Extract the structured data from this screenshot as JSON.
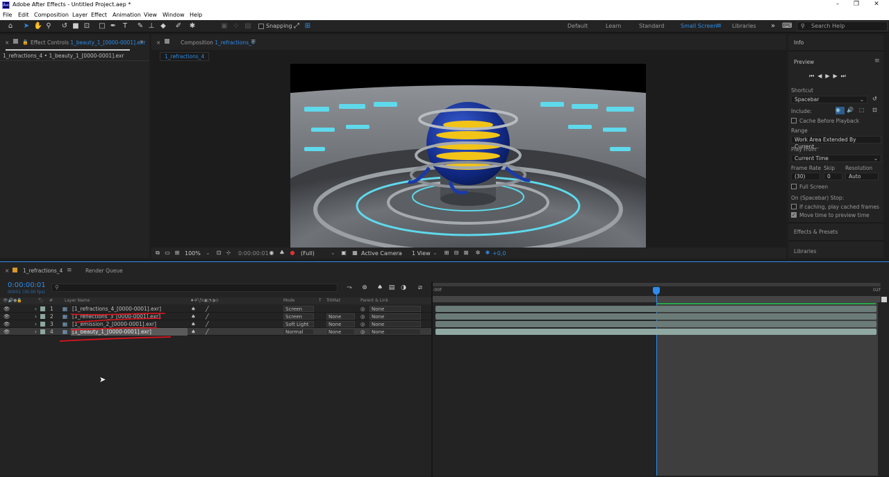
{
  "titlebar": {
    "title": "Adobe After Effects - Untitled Project.aep *",
    "app_icon": "Ae"
  },
  "menu": [
    "File",
    "Edit",
    "Composition",
    "Layer",
    "Effect",
    "Animation",
    "View",
    "Window",
    "Help"
  ],
  "toolbar": {
    "snapping": "Snapping",
    "workspaces": [
      "Default",
      "Learn",
      "Standard",
      "Small Screen",
      "Libraries"
    ],
    "active_workspace": "Small Screen",
    "search_placeholder": "Search Help"
  },
  "effect_controls": {
    "tab_prefix": "Effect Controls",
    "tab_target": "1_beauty_1_[0000-0001].exr",
    "subtitle": "1_refractions_4 • 1_beauty_1_[0000-0001].exr"
  },
  "composition": {
    "tab_prefix": "Composition",
    "tab_name": "1_refractions_4",
    "sub_tab": "1_refractions_4"
  },
  "viewer_bar": {
    "zoom": "100%",
    "time": "0:00:00:01",
    "resolution": "(Full)",
    "camera": "Active Camera",
    "views": "1 View",
    "exposure": "+0,0"
  },
  "right_panel": {
    "info": "Info",
    "preview": "Preview",
    "shortcut_label": "Shortcut",
    "shortcut_value": "Spacebar",
    "include_label": "Include:",
    "cache_before": "Cache Before Playback",
    "range_label": "Range",
    "range_value": "Work Area Extended By Current...",
    "play_from_label": "Play From",
    "play_from_value": "Current Time",
    "frame_rate_label": "Frame Rate",
    "skip_label": "Skip",
    "resolution_label": "Resolution",
    "frame_rate_value": "(30)",
    "skip_value": "0",
    "resolution_value": "Auto",
    "full_screen": "Full Screen",
    "on_stop": "On (Spacebar) Stop:",
    "if_caching": "If caching, play cached frames",
    "move_time": "Move time to preview time",
    "effects_presets": "Effects & Presets",
    "libraries": "Libraries"
  },
  "timeline": {
    "tab": "1_refractions_4",
    "render_queue": "Render Queue",
    "timecode": "0:00:00:01",
    "fps": "00001 (30.00 fps)",
    "cols": {
      "num": "#",
      "layer_name": "Layer Name",
      "mode": "Mode",
      "t": "T",
      "trkmat": "TrkMat",
      "parent": "Parent & Link"
    },
    "ruler": {
      "start": ":00f",
      "end": "02f"
    },
    "layers": [
      {
        "num": "1",
        "name": "[1_refractions_4_[0000-0001].exr]",
        "mode": "Screen",
        "trkmat": "",
        "parent": "None"
      },
      {
        "num": "2",
        "name": "[1_reflections_3_[0000-0001].exr]",
        "mode": "Screen",
        "trkmat": "None",
        "parent": "None"
      },
      {
        "num": "3",
        "name": "[1_emission_2_[0000-0001].exr]",
        "mode": "Soft Light",
        "trkmat": "None",
        "parent": "None"
      },
      {
        "num": "4",
        "name": "[1_beauty_1_[0000-0001].exr]",
        "mode": "Normal",
        "trkmat": "None",
        "parent": "None"
      }
    ]
  },
  "colors": {
    "accent": "#2d8ceb",
    "panel": "#232323",
    "bg": "#1d1d1d",
    "annotation": "#e0141e",
    "layer_bar": "#6b7c78"
  }
}
